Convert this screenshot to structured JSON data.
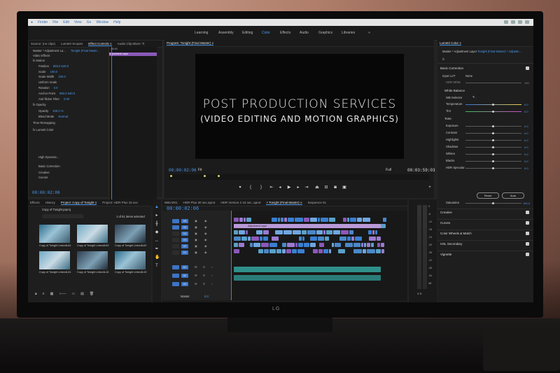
{
  "menubar": {
    "items": [
      "Finder",
      "File",
      "Edit",
      "View",
      "Go",
      "Window",
      "Help"
    ]
  },
  "workspace_tabs": [
    {
      "label": "Learning",
      "x": 0,
      "active": false
    },
    {
      "label": "Assembly",
      "active": false
    },
    {
      "label": "Editing",
      "active": false
    },
    {
      "label": "Color",
      "active": true
    },
    {
      "label": "Effects",
      "active": false
    },
    {
      "label": "Audio",
      "active": false
    },
    {
      "label": "Graphics",
      "active": false
    },
    {
      "label": "Libraries",
      "active": false
    },
    {
      "label": "»",
      "active": false
    }
  ],
  "effect_controls": {
    "tabs": [
      "Source: (no clips)",
      "Lumetri Scopes",
      "Effect Controls ≡",
      "Audio Clip Mixer: Ti"
    ],
    "master": "Master * Adjustment La...",
    "sequence": "Tonight (Final Maste...",
    "timecode_start": ":00:00",
    "clip_label": "Adjustment Layer",
    "rows": [
      {
        "label": "Video Effects",
        "value": ""
      },
      {
        "label": "fx  Motion",
        "value": ""
      },
      {
        "label": "Position",
        "value": "960.0   540.0"
      },
      {
        "label": "Scale",
        "value": "100.0"
      },
      {
        "label": "Scale Width",
        "value": "100.0"
      },
      {
        "label": "Uniform Scale",
        "value": ""
      },
      {
        "label": "Rotation",
        "value": "0.0"
      },
      {
        "label": "Anchor Point",
        "value": "960.0   540.0"
      },
      {
        "label": "Anti-flicker Filter",
        "value": "0.00"
      },
      {
        "label": "fx  Opacity",
        "value": ""
      },
      {
        "label": "Opacity",
        "value": "100.0 %"
      },
      {
        "label": "Blend Mode",
        "value": "Normal"
      },
      {
        "label": "Time Remapping",
        "value": ""
      },
      {
        "label": "fx  Lumetri Color",
        "value": ""
      },
      {
        "label": "High Dynamic...",
        "value": ""
      },
      {
        "label": "Basic Correction",
        "value": ""
      },
      {
        "label": "Creative",
        "value": ""
      },
      {
        "label": "Curves",
        "value": ""
      },
      {
        "label": "Color Wheels & Match",
        "value": ""
      },
      {
        "label": "HSL Secondary",
        "value": ""
      },
      {
        "label": "Vignette",
        "value": ""
      }
    ],
    "timecode_bottom": "00:00:02:06"
  },
  "program": {
    "tab": "Program: Tonight (Final Master) ≡",
    "title_line1": "POST PRODUCTION SERVICES",
    "title_line2": "(VIDEO EDITING AND MOTION GRAPHICS)",
    "timecode_current": "00:00:02:06",
    "fit": "Fit",
    "quality": "Full",
    "timecode_duration": "00:03:59:03"
  },
  "lumetri": {
    "tabs": "Lumetri Color ≡",
    "master": "Master * Adjustment Layer",
    "sequence": "Tonight (Final Master) * Adjustm...",
    "basic_correction": "Basic Correction",
    "input_lut_label": "Input LUT",
    "input_lut_value": "None",
    "hdr_white_label": "HDR White",
    "hdr_white_value": "100",
    "white_balance": "White Balance",
    "wb_selector": "WB Selector",
    "sliders": [
      {
        "label": "Temperature",
        "value": "0.0"
      },
      {
        "label": "Tint",
        "value": "0.0"
      }
    ],
    "tone": "Tone",
    "tone_sliders": [
      {
        "label": "Exposure",
        "value": "0.0"
      },
      {
        "label": "Contrast",
        "value": "0.0"
      },
      {
        "label": "Highlights",
        "value": "0.0"
      },
      {
        "label": "Shadows",
        "value": "0.0"
      },
      {
        "label": "Whites",
        "value": "0.0"
      },
      {
        "label": "Blacks",
        "value": "0.0"
      },
      {
        "label": "HDR Specular",
        "value": "0.0"
      }
    ],
    "reset": "Reset",
    "auto": "Auto",
    "saturation_label": "Saturation",
    "saturation_value": "100.0",
    "sections": [
      "Creative",
      "Curves",
      "Color Wheels & Match",
      "HSL Secondary",
      "Vignette"
    ]
  },
  "project": {
    "tabs": [
      "Effects",
      "History",
      "Project: Copy of Tonight ≡",
      "Project: HDR Plus 15 sec"
    ],
    "file": "Copy of Tonight.prproj",
    "items_selected": "1 of 61 items selected",
    "thumbs": [
      {
        "label": "Copy of Tonight Linked...",
        "dur": "1:04"
      },
      {
        "label": "Copy of Tonight Linked...",
        "dur": "2:09"
      },
      {
        "label": "Copy of Tonight Linked...",
        "dur": "0:00"
      },
      {
        "label": "Copy of Tonight Linked...",
        "dur": "1:24"
      },
      {
        "label": "Copy of Tonight Linked...",
        "dur": "1:16"
      },
      {
        "label": "Copy of Tonight Linked...",
        "dur": "0:19"
      }
    ]
  },
  "timeline": {
    "tabs": [
      "96EA001",
      "HDR Plus 30 sec.aprot",
      "HDR Version 2 15 sec..aprot",
      "× Tonight (Final Master) ≡",
      "Sequence 01"
    ],
    "timecode": "00:00:02:06",
    "ruler": [
      "00:00",
      "00:00:14:23",
      "00:00:29:23",
      "00:00:44:22",
      "00:00:59:22",
      "00:01:14:22",
      "00:01:29:21",
      "00:01:44:21",
      "00:01:59:21"
    ],
    "video_tracks": [
      "V6",
      "V5",
      "V4",
      "V3",
      "V2",
      "V1"
    ],
    "audio_tracks": [
      "A1",
      "A2",
      "A3"
    ],
    "master": "Master",
    "master_value": "0.0",
    "adjustment_label": "Adjustment Layer"
  },
  "meter": {
    "labels": [
      "0",
      "-6",
      "-12",
      "-18",
      "-24",
      "-30",
      "-36",
      "-42",
      "-48",
      "-54",
      "dB"
    ],
    "bottom": "S   S"
  },
  "monitor": {
    "brand": "LG"
  },
  "colors": {
    "accent": "#4b9cf0",
    "purple": "#8a59b8",
    "teal": "#3a8fa0"
  }
}
